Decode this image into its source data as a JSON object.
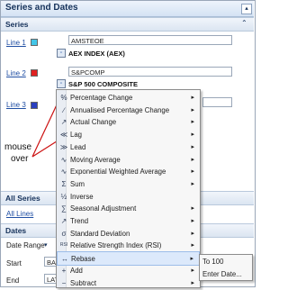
{
  "panel": {
    "title": "Series and Dates",
    "collapse_symbol": "▴"
  },
  "series_section": {
    "label": "Series",
    "chevron": "⌃",
    "lines": [
      {
        "label": "Line 1",
        "color": "#43c6e8",
        "code": "AMSTEOE",
        "name": "AEX INDEX (AEX)"
      },
      {
        "label": "Line 2",
        "color": "#e02020",
        "code": "S&PCOMP",
        "name": "S&P 500 COMPOSITE"
      },
      {
        "label": "Line 3",
        "color": "#2a3fbf"
      }
    ]
  },
  "annotation": {
    "text_line1": "mouse",
    "text_line2": "over",
    "line_color": "#cc1111"
  },
  "all_series": {
    "label": "All Series",
    "link": "All Lines"
  },
  "dates": {
    "label": "Dates",
    "date_range_label": "Date Range",
    "start_label": "Start",
    "start_value": "BAS",
    "end_label": "End",
    "end_value": "LAT"
  },
  "context_menu": {
    "items": [
      {
        "icon": "%",
        "label": "Percentage Change",
        "has_submenu": true
      },
      {
        "icon": "∕",
        "label": "Annualised Percentage Change",
        "has_submenu": true
      },
      {
        "icon": "↗",
        "label": "Actual Change",
        "has_submenu": true
      },
      {
        "icon": "≪",
        "label": "Lag",
        "has_submenu": true
      },
      {
        "icon": "≫",
        "label": "Lead",
        "has_submenu": true
      },
      {
        "icon": "∿",
        "label": "Moving Average",
        "has_submenu": true
      },
      {
        "icon": "∿",
        "label": "Exponential Weighted Average",
        "has_submenu": true
      },
      {
        "icon": "Σ",
        "label": "Sum",
        "has_submenu": true
      },
      {
        "icon": "½",
        "label": "Inverse",
        "has_submenu": false
      },
      {
        "icon": "∑",
        "label": "Seasonal Adjustment",
        "has_submenu": true
      },
      {
        "icon": "↗",
        "label": "Trend",
        "has_submenu": true
      },
      {
        "icon": "σ",
        "label": "Standard Deviation",
        "has_submenu": true
      },
      {
        "icon": "RSI",
        "label": "Relative Strength Index (RSI)",
        "has_submenu": true
      },
      {
        "icon": "↔",
        "label": "Rebase",
        "has_submenu": true,
        "highlighted": true
      },
      {
        "icon": "+",
        "label": "Add",
        "has_submenu": true
      },
      {
        "icon": "−",
        "label": "Subtract",
        "has_submenu": true
      }
    ],
    "arrow_symbol": "▸"
  },
  "rebase_submenu": {
    "items": [
      {
        "label": "To 100"
      },
      {
        "label": "Enter Date..."
      }
    ]
  }
}
